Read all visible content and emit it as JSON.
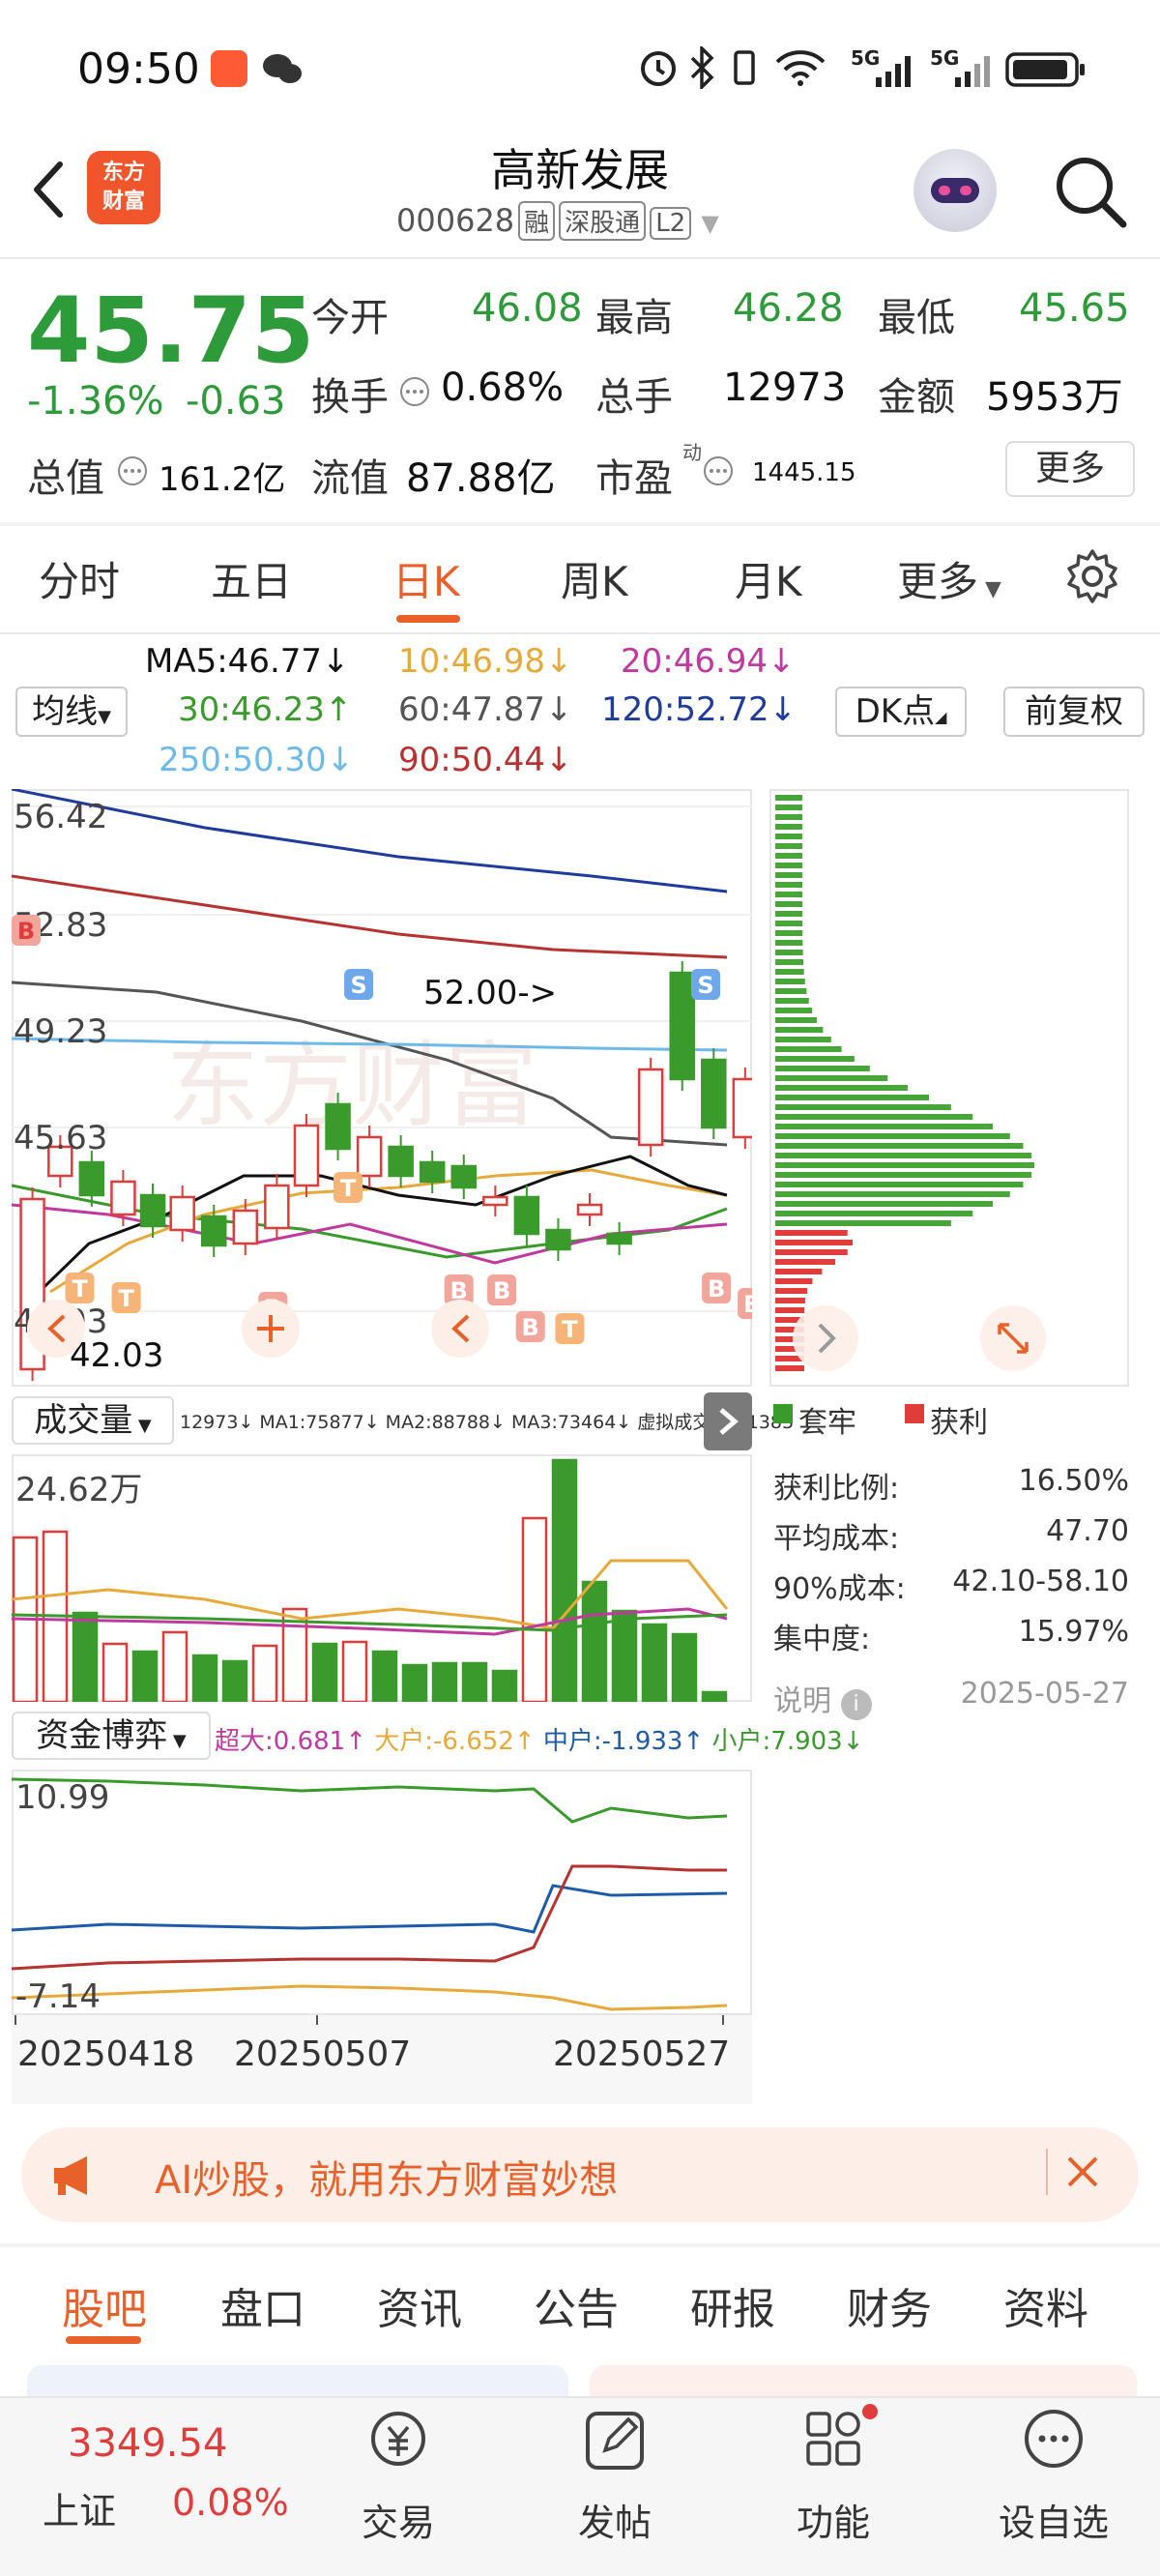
{
  "status_bar": {
    "time": "09:50",
    "net1": "5G",
    "net2": "5G"
  },
  "header": {
    "logo_line1": "东方",
    "logo_line2": "财富",
    "title": "高新发展",
    "code": "000628",
    "tags": [
      "融",
      "深股通",
      "L2"
    ]
  },
  "quote": {
    "price": "45.75",
    "change_pct": "-1.36%",
    "change": "-0.63",
    "open_label": "今开",
    "open": "46.08",
    "high_label": "最高",
    "high": "46.28",
    "low_label": "最低",
    "low": "45.65",
    "turnover_label": "换手",
    "turnover": "0.68%",
    "volume_label": "总手",
    "volume": "12973",
    "amount_label": "金额",
    "amount": "5953万",
    "mktcap_label": "总值",
    "mktcap": "161.2亿",
    "float_label": "流值",
    "float": "87.88亿",
    "pe_label": "市盈",
    "pe_sup": "动",
    "pe": "1445.15",
    "more": "更多"
  },
  "tabs": [
    "分时",
    "五日",
    "日K",
    "周K",
    "月K",
    "更多"
  ],
  "active_tab": "日K",
  "ma_legend": {
    "selector": "均线",
    "ma5": "MA5:46.77↓",
    "ma10": "10:46.98↓",
    "ma20": "20:46.94↓",
    "ma30": "30:46.23↑",
    "ma60": "60:47.87↓",
    "ma120": "120:52.72↓",
    "ma250": "250:50.30↓",
    "ma90": "90:50.44↓",
    "dk": "DK点",
    "fq": "前复权"
  },
  "colors": {
    "up": "#e03c3c",
    "down": "#3a9a2c",
    "ma5": "#111111",
    "ma10": "#e8a93b",
    "ma20": "#c0399e",
    "ma30": "#3a9a2c",
    "ma60": "#555555",
    "ma120": "#1f3c9c",
    "ma250": "#6db9ea",
    "ma90": "#b83232",
    "accent": "#e8612b"
  },
  "kchart": {
    "y_labels": [
      "56.42",
      "52.83",
      "49.23",
      "45.63",
      "42.03"
    ],
    "annotation_max": "52.00->",
    "annotation_min": "42.03",
    "watermark": "东方财富"
  },
  "volume": {
    "selector": "成交量",
    "legend": "12973↓ MA1:75877↓ MA2:88788↓ MA3:73464↓ 虚拟成交量:61383",
    "y_label": "24.62万"
  },
  "capital": {
    "selector": "资金博弈",
    "chaoda": "超大:0.681↑",
    "dahu": "大户:-6.652↑",
    "zhonghu": "中户:-1.933↑",
    "xiaohu": "小户:7.903↓",
    "y_top": "10.99",
    "y_bottom": "-7.14"
  },
  "x_labels": [
    "20250418",
    "20250507",
    "20250527"
  ],
  "chip": {
    "legend_trap": "套牢",
    "legend_profit": "获利",
    "stats": [
      {
        "label": "获利比例:",
        "value": "16.50%"
      },
      {
        "label": "平均成本:",
        "value": "47.70"
      },
      {
        "label": "90%成本:",
        "value": "42.10-58.10"
      },
      {
        "label": "集中度:",
        "value": "15.97%"
      }
    ],
    "note_label": "说明",
    "date": "2025-05-27"
  },
  "banner": {
    "text": "AI炒股，就用东方财富妙想"
  },
  "bottom_tabs": [
    "股吧",
    "盘口",
    "资讯",
    "公告",
    "研报",
    "财务",
    "资料"
  ],
  "bottom_nav": {
    "index_value": "3349.54",
    "index_name": "上证",
    "index_change": "0.08%",
    "items": [
      "交易",
      "发帖",
      "功能",
      "设自选"
    ]
  }
}
